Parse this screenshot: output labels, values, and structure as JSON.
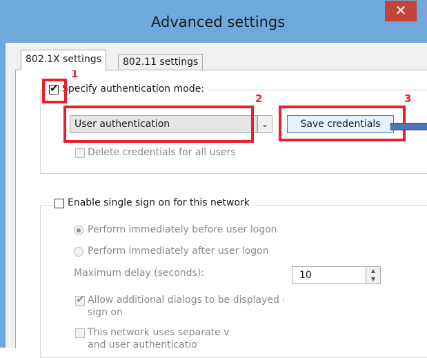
{
  "window": {
    "title": "Advanced settings",
    "close_glyph": "✕"
  },
  "tabs": [
    {
      "label": "802.1X settings",
      "active": true
    },
    {
      "label": "802.11 settings",
      "active": false
    }
  ],
  "auth": {
    "checkbox_label": "Specify authentication mode:",
    "checked": true,
    "mode_value": "User authentication",
    "save_button": "Save credentials",
    "delete_label": "Delete credentials for all users"
  },
  "sso": {
    "checkbox_label": "Enable single sign on for this network",
    "checked": false,
    "radio_before": "Perform immediately before user logon",
    "radio_after": "Perform immediately after user logon",
    "radio_selected": "before",
    "delay_label": "Maximum delay (seconds):",
    "delay_value": "10",
    "allow_dialogs_line1": "Allow additional dialogs to be displayed during single",
    "allow_dialogs_line2": "sign on",
    "allow_dialogs_checked": true,
    "separate_line1": "This network uses separate v",
    "separate_line2": "and user authenticatio"
  },
  "annotations": [
    "1",
    "2",
    "3"
  ],
  "colors": {
    "highlight": "#e8202a",
    "window_frame": "#6fa9dc",
    "close_button": "#c6433a",
    "arrow": "#4c77b6"
  }
}
